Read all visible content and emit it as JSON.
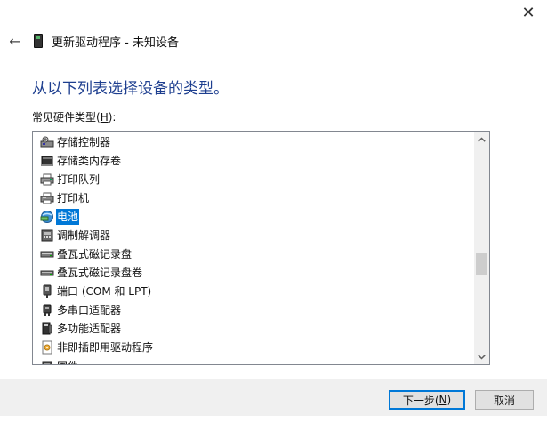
{
  "window": {
    "close_label": "✕"
  },
  "header": {
    "back_label": "←",
    "title": "更新驱动程序 - 未知设备"
  },
  "instruction": "从以下列表选择设备的类型。",
  "list": {
    "label_prefix": "常见硬件类型(",
    "label_accel": "H",
    "label_suffix": "):",
    "items": [
      {
        "label": "存储控制器",
        "icon": "storage-controller-icon",
        "selected": false
      },
      {
        "label": "存储类内存卷",
        "icon": "storage-volume-icon",
        "selected": false
      },
      {
        "label": "打印队列",
        "icon": "print-queue-icon",
        "selected": false
      },
      {
        "label": "打印机",
        "icon": "printer-icon",
        "selected": false
      },
      {
        "label": "电池",
        "icon": "battery-icon",
        "selected": true
      },
      {
        "label": "调制解调器",
        "icon": "modem-icon",
        "selected": false
      },
      {
        "label": "叠瓦式磁记录盘",
        "icon": "smr-disk-icon",
        "selected": false
      },
      {
        "label": "叠瓦式磁记录盘卷",
        "icon": "smr-volume-icon",
        "selected": false
      },
      {
        "label": "端口 (COM 和 LPT)",
        "icon": "port-icon",
        "selected": false
      },
      {
        "label": "多串口适配器",
        "icon": "multiport-serial-icon",
        "selected": false
      },
      {
        "label": "多功能适配器",
        "icon": "multifunction-adapter-icon",
        "selected": false
      },
      {
        "label": "非即插即用驱动程序",
        "icon": "non-pnp-driver-icon",
        "selected": false
      },
      {
        "label": "固件",
        "icon": "firmware-icon",
        "selected": false
      }
    ]
  },
  "buttons": {
    "next_prefix": "下一步(",
    "next_accel": "N",
    "next_suffix": ")",
    "cancel": "取消"
  },
  "colors": {
    "instruction": "#1d3e8f",
    "selection": "#0078d7",
    "footer_bg": "#f0f0f0"
  }
}
